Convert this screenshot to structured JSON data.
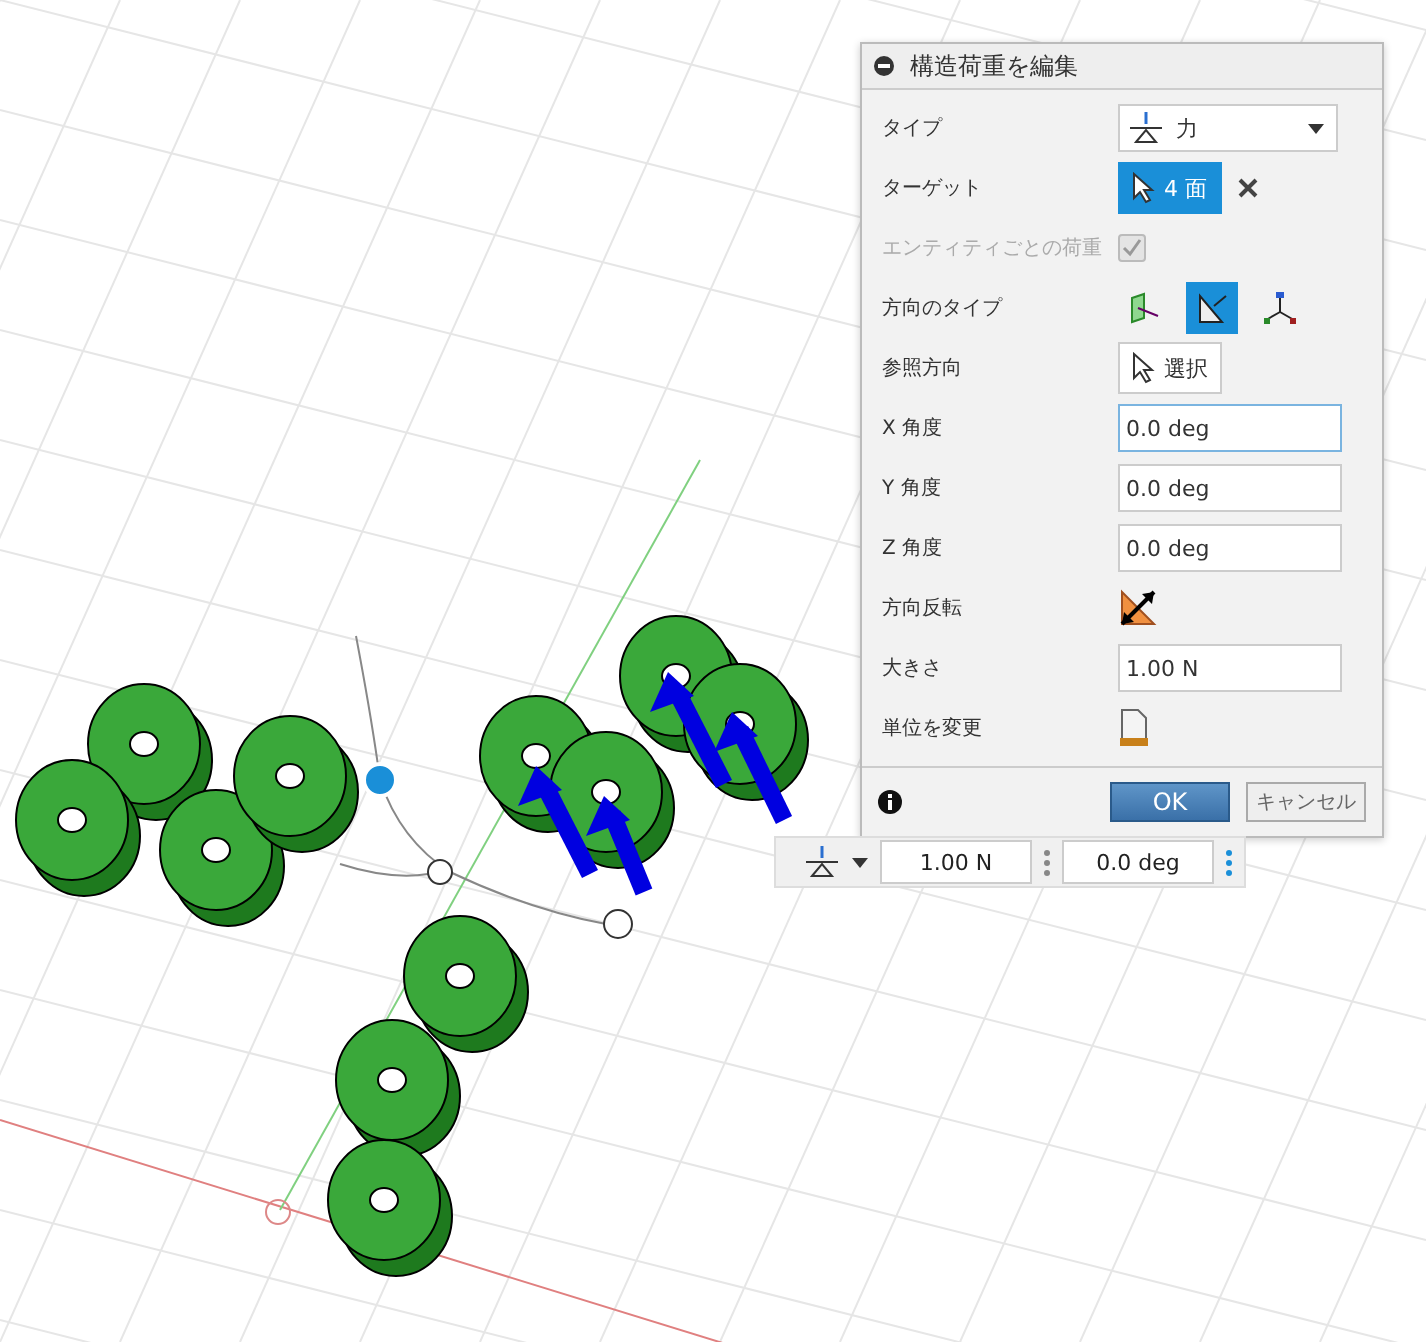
{
  "dialog": {
    "title": "構造荷重を編集",
    "rows": [
      {
        "kind": "select",
        "label": "タイプ",
        "value": "力"
      },
      {
        "kind": "target",
        "label": "ターゲット",
        "value": "4 面",
        "selected": true
      },
      {
        "kind": "checkbox",
        "label": "エンティティごとの荷重",
        "checked": true,
        "disabled": true
      },
      {
        "kind": "direction",
        "label": "方向のタイプ",
        "options": [
          {
            "selected": false
          },
          {
            "selected": true
          },
          {
            "selected": false
          }
        ]
      },
      {
        "kind": "pick",
        "label": "参照方向",
        "value": "選択"
      },
      {
        "kind": "input",
        "label": "X 角度",
        "value": "0.0 deg",
        "focused": true
      },
      {
        "kind": "input",
        "label": "Y 角度",
        "value": "0.0 deg",
        "focused": false
      },
      {
        "kind": "input",
        "label": "Z 角度",
        "value": "0.0 deg",
        "focused": false
      },
      {
        "kind": "flip",
        "label": "方向反転"
      },
      {
        "kind": "input",
        "label": "大きさ",
        "value": "1.00 N",
        "focused": false
      },
      {
        "kind": "unit",
        "label": "単位を変更"
      }
    ],
    "ok": "OK",
    "cancel": "キャンセル"
  },
  "mini_toolbar": {
    "magnitude": "1.00 N",
    "angle": "0.0 deg"
  }
}
